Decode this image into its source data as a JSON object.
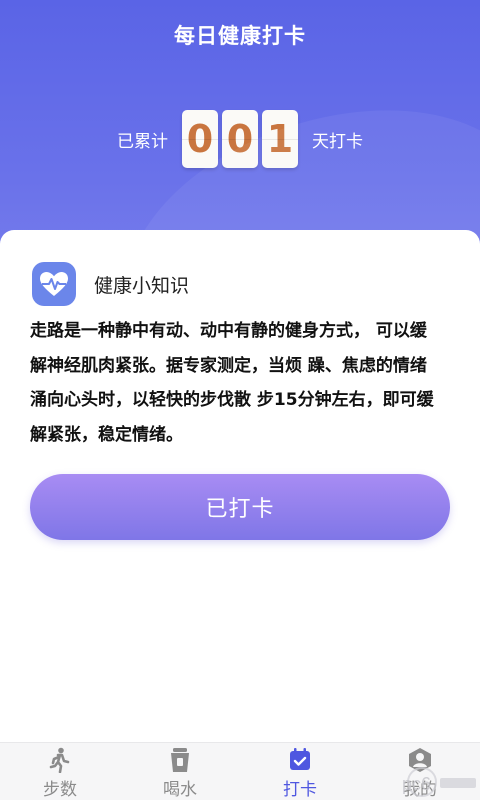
{
  "header": {
    "title": "每日健康打卡",
    "counter_prefix": "已累计",
    "counter_digits": [
      "0",
      "0",
      "1"
    ],
    "counter_suffix": "天打卡"
  },
  "tip": {
    "title": "健康小知识",
    "lines": [
      "走路是一种静中有动、动中有静的健身方式， 可以缓",
      "解神经肌肉紧张。据专家测定，当烦 躁、焦虑的情绪",
      "涌向心头时，以轻快的步伐散 步15分钟左右，即可缓",
      "解紧张，稳定情绪。"
    ],
    "icon": "heart-pulse-icon"
  },
  "checkin_button": {
    "label": "已打卡"
  },
  "tabbar": {
    "tabs": [
      {
        "label": "步数",
        "icon": "walking-icon",
        "active": false
      },
      {
        "label": "喝水",
        "icon": "cup-icon",
        "active": false
      },
      {
        "label": "打卡",
        "icon": "calendar-check-icon",
        "active": true
      },
      {
        "label": "我的",
        "icon": "user-icon",
        "active": false
      }
    ]
  },
  "colors": {
    "accent": "#5a64e6",
    "digit": "#c9753f",
    "button_top": "#a88cf3",
    "button_bottom": "#7f76e7",
    "tab_active": "#4f57e0",
    "tab_inactive": "#8b8b8b"
  }
}
